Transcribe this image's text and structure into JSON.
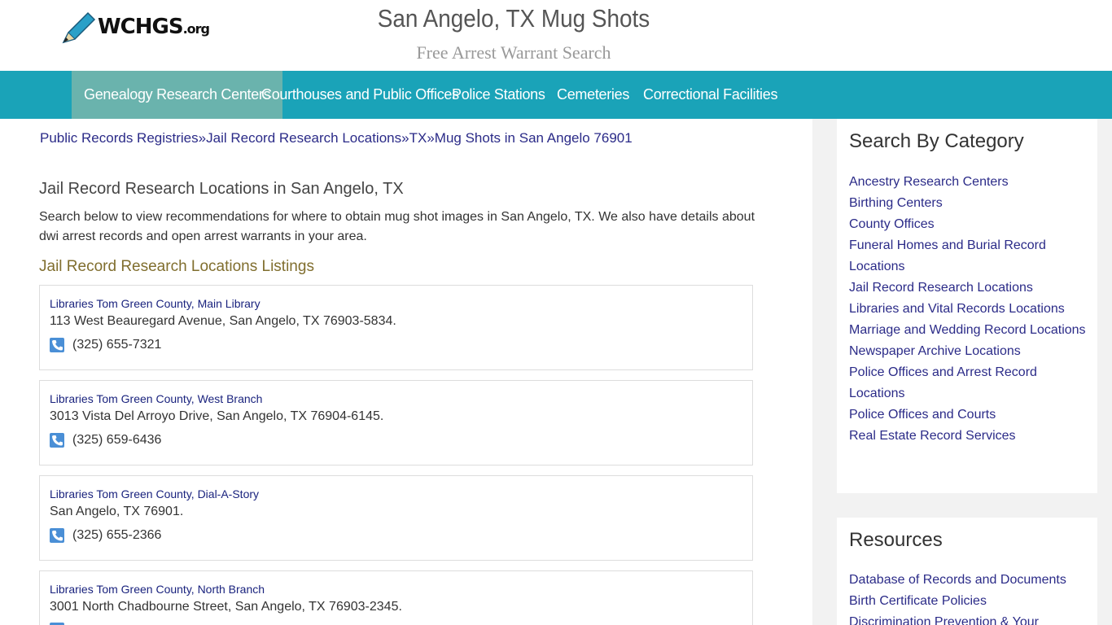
{
  "header": {
    "logo_text": "WCHGS",
    "logo_suffix": ".org",
    "title": "San Angelo, TX Mug Shots",
    "subtitle": "Free Arrest Warrant Search"
  },
  "nav": {
    "items": [
      {
        "label": "Genealogy Research Centers",
        "active": true
      },
      {
        "label": "Courthouses and Public Offices",
        "active": false
      },
      {
        "label": "Police Stations",
        "active": false
      },
      {
        "label": "Cemeteries",
        "active": false
      },
      {
        "label": "Correctional Facilities",
        "active": false
      }
    ]
  },
  "breadcrumb": {
    "items": [
      "Public Records Registries",
      "Jail Record Research Locations",
      "TX",
      "Mug Shots in San Angelo 76901"
    ],
    "separator": "»"
  },
  "main": {
    "heading": "Jail Record Research Locations in San Angelo, TX",
    "intro": "Search below to view recommendations for where to obtain mug shot images in San Angelo, TX. We also have details about dwi arrest records and open arrest warrants in your area.",
    "listings_heading": "Jail Record Research Locations Listings",
    "listings": [
      {
        "name": "Libraries Tom Green County, Main Library",
        "address": "113 West Beauregard Avenue, San Angelo, TX 76903-5834.",
        "phone": "(325) 655-7321"
      },
      {
        "name": "Libraries Tom Green County, West Branch",
        "address": "3013 Vista Del Arroyo Drive, San Angelo, TX 76904-6145.",
        "phone": "(325) 659-6436"
      },
      {
        "name": "Libraries Tom Green County, Dial-A-Story",
        "address": "San Angelo, TX 76901.",
        "phone": "(325) 655-2366"
      },
      {
        "name": "Libraries Tom Green County, North Branch",
        "address": "3001 North Chadbourne Street, San Angelo, TX 76903-2345.",
        "phone": ""
      }
    ]
  },
  "sidebar": {
    "category_title": "Search By Category",
    "categories": [
      "Ancestry Research Centers",
      "Birthing Centers",
      "County Offices",
      "Funeral Homes and Burial Record Locations",
      "Jail Record Research Locations",
      "Libraries and Vital Records Locations",
      "Marriage and Wedding Record Locations",
      "Newspaper Archive Locations",
      "Police Offices and Arrest Record Locations",
      "Police Offices and Courts",
      "Real Estate Record Services"
    ],
    "resources_title": "Resources",
    "resources": [
      "Database of Records and Documents",
      "Birth Certificate Policies",
      "Discrimination Prevention & Your"
    ]
  },
  "colors": {
    "nav_bg": "#1aa3b8",
    "nav_active": "#6ab3ad",
    "link": "#2b2b88",
    "listings_heading": "#806e2e",
    "phone_icon": "#4a8fd6"
  }
}
